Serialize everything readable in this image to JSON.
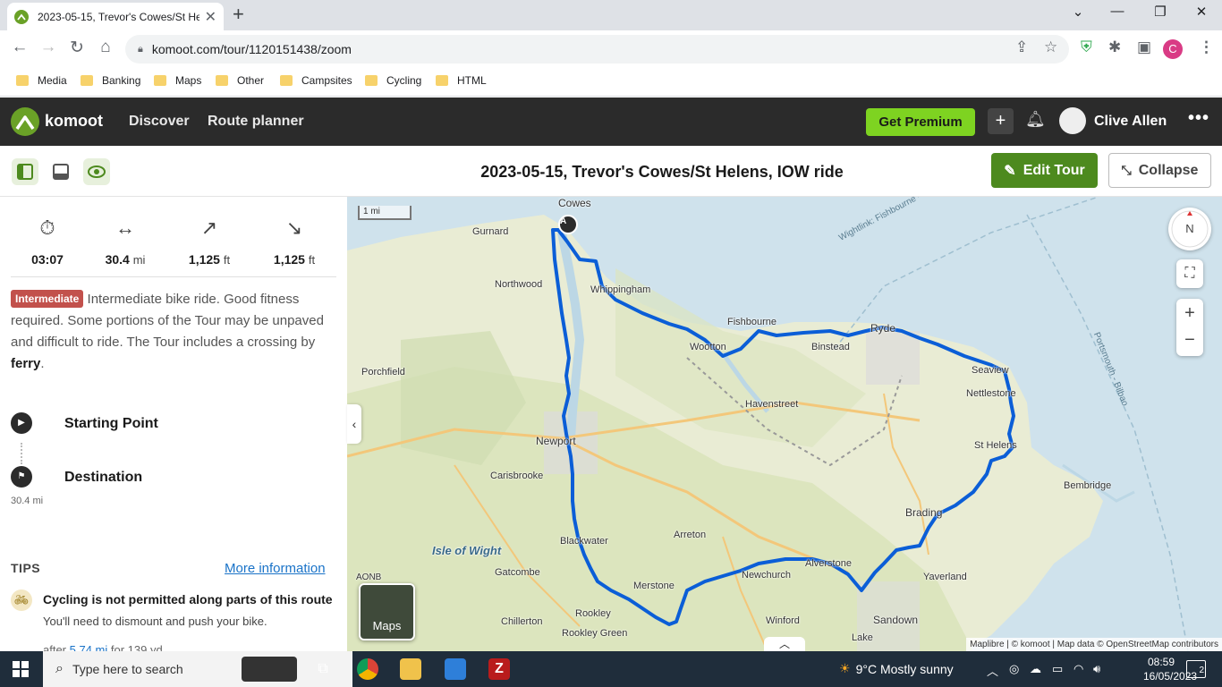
{
  "browser": {
    "tab_title": "2023-05-15, Trevor's Cowes/St Helens, IOW ride",
    "url": "komoot.com/tour/1120151438/zoom",
    "profile_initial": "C",
    "bookmarks": [
      "Media",
      "Banking",
      "Maps",
      "Other",
      "Campsites",
      "Cycling",
      "HTML"
    ]
  },
  "header": {
    "brand": "komoot",
    "nav": [
      "Discover",
      "Route planner"
    ],
    "premium": "Get Premium",
    "user": "Clive Allen"
  },
  "tour": {
    "title": "2023-05-15, Trevor's Cowes/St Helens, IOW ride",
    "edit_label": "Edit Tour",
    "collapse_label": "Collapse"
  },
  "stats": {
    "duration": "03:07",
    "distance": "30.4",
    "distance_unit": "mi",
    "uphill": "1,125",
    "uphill_unit": "ft",
    "downhill": "1,125",
    "downhill_unit": "ft"
  },
  "difficulty": {
    "badge": "Intermediate",
    "text": "Intermediate bike ride. Good fitness required. Some portions of the Tour may be unpaved and difficult to ride. The Tour includes a crossing by ",
    "bold": "ferry",
    "end": "."
  },
  "waypoints": {
    "start": "Starting Point",
    "destination": "Destination",
    "distance": "30.4 mi"
  },
  "tips": {
    "heading": "TIPS",
    "more": "More information",
    "title": "Cycling is not permitted along parts of this route",
    "text": "You'll need to dismount and push your bike.",
    "more_prefix": "after ",
    "more_link": "5.74 mi",
    "more_suffix": " for 139 yd"
  },
  "map": {
    "scale": "1 mi",
    "compass": "N",
    "maps_btn": "Maps",
    "start_marker": "A",
    "attribution": "Maplibre | © komoot | Map data © OpenStreetMap contributors",
    "ferry_label": "Wightlink: Fishbourne - Portsm",
    "ferry_label2": "Portsmouth - Bilbao",
    "places": [
      "Cowes",
      "Gurnard",
      "Whippingham",
      "Northwood",
      "Fishbourne",
      "Wootton",
      "Binstead",
      "Ryde",
      "Seaview",
      "Nettlestone",
      "Porchfield",
      "Havenstreet",
      "Newport",
      "St Helens",
      "Carisbrooke",
      "Bembridge",
      "Brading",
      "Isle of Wight",
      "Arreton",
      "Blackwater",
      "Gatcombe",
      "Merstone",
      "Newchurch",
      "Alverstone",
      "Yaverland",
      "AONB",
      "Chillerton",
      "Rookley",
      "Rookley Green",
      "Winford",
      "Sandown",
      "Lake"
    ]
  },
  "taskbar": {
    "search_placeholder": "Type here to search",
    "temperature": "9°C",
    "weather": "Mostly sunny",
    "time": "08:59",
    "date": "16/05/2023",
    "notifications": "2"
  }
}
